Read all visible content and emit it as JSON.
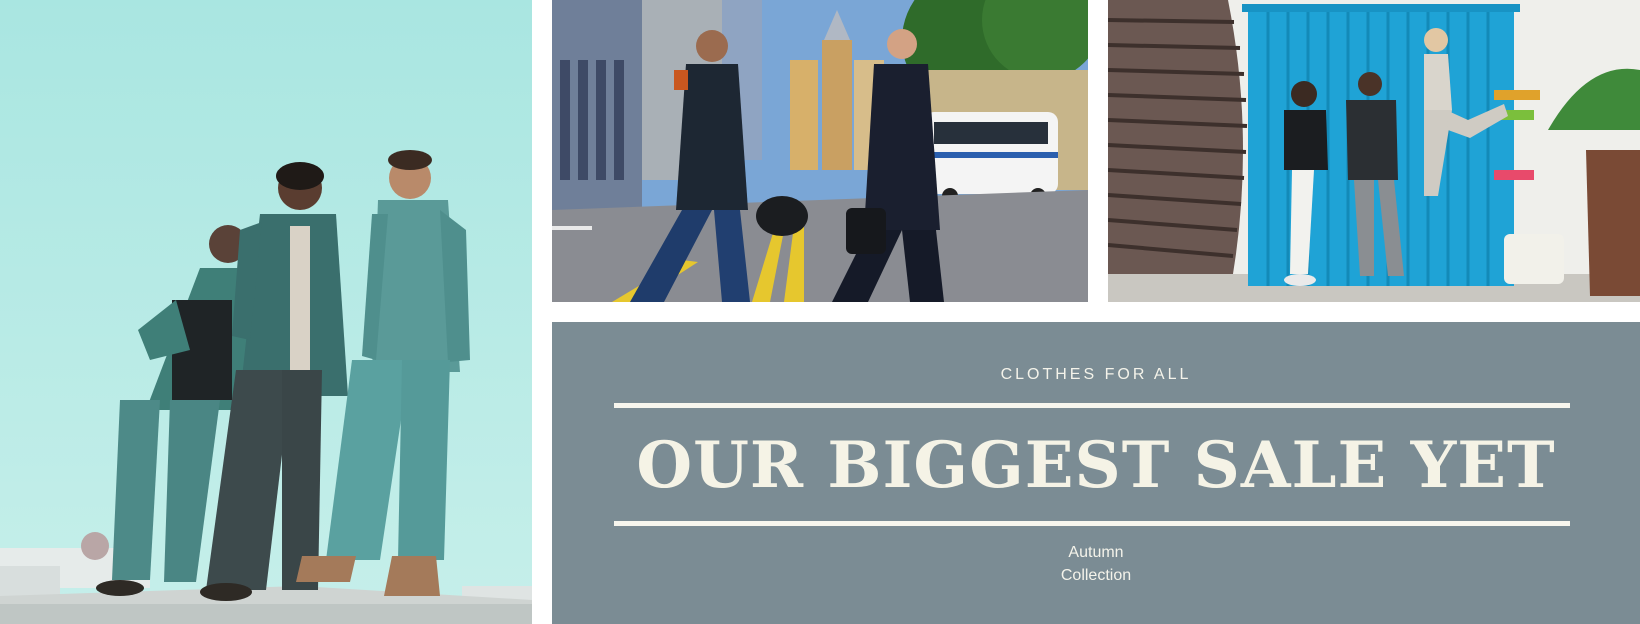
{
  "photos": {
    "left": {
      "icon": "three-men-on-rooftop-photo"
    },
    "street": {
      "icon": "businessmen-crossing-street-photo"
    },
    "sport": {
      "icon": "athletes-by-blue-container-photo"
    }
  },
  "promo": {
    "subtitle": "CLOTHES FOR ALL",
    "headline": "OUR BIGGEST SALE YET",
    "caption_line1": "Autumn",
    "caption_line2": "Collection",
    "background_color": "#7b8c94",
    "text_color": "#f5f3e6"
  }
}
